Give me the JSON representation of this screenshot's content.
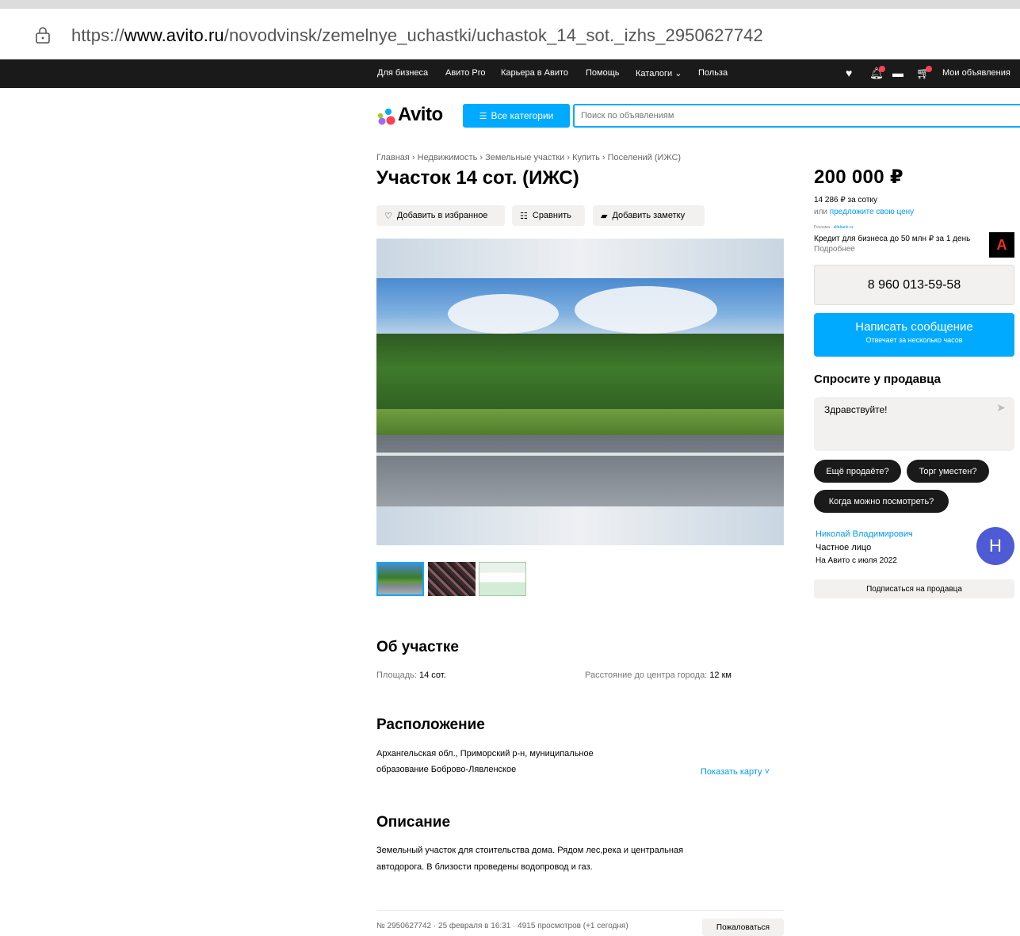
{
  "browser": {
    "url_scheme": "https://",
    "url_host": "www.avito.ru",
    "url_path": "/novodvinsk/zemelnye_uchastki/uchastok_14_sot._izhs_2950627742"
  },
  "topnav": {
    "items": [
      "Для бизнеса",
      "Авито Pro",
      "Карьера в Авито",
      "Помощь",
      "Каталоги ⌄",
      "Польза"
    ],
    "my_ads": "Мои объявления"
  },
  "header": {
    "logo": "Avito",
    "categories_button": "Все категории",
    "search_placeholder": "Поиск по объявлениям"
  },
  "breadcrumbs": "Главная › Недвижимость › Земельные участки › Купить › Поселений (ИЖС)",
  "listing": {
    "title": "Участок 14 сот. (ИЖС)",
    "actions": {
      "favorite": "Добавить в избранное",
      "compare": "Сравнить",
      "note": "Добавить заметку"
    },
    "about": {
      "heading": "Об участке",
      "area_label": "Площадь:",
      "area_value": "14 сот.",
      "distance_label": "Расстояние до центра города:",
      "distance_value": "12 км"
    },
    "location": {
      "heading": "Расположение",
      "line1": "Архангельская обл., Приморский р-н, муниципальное",
      "line2": "образование Боброво-Лявленское",
      "show_map": "Показать карту ˅"
    },
    "description": {
      "heading": "Описание",
      "line1": "Земельный участок для стоительства дома. Рядом лес,река и центральная",
      "line2": "автодорога. В близости проведены водопровод и газ."
    },
    "footer": {
      "meta": "№ 2950627742 · 25 февраля в 16:31 · 4915 просмотров (+1 сегодня)",
      "report": "Пожаловаться"
    }
  },
  "sidebar": {
    "price": "200 000 ₽",
    "price_per_sotka": "14 286 ₽ за сотку",
    "offer_prefix": "или ",
    "offer_link": "предложите свою цену",
    "ad_label": "Реклама ·",
    "ad_domain": "alfabank.ru",
    "ad_text_bold": "Кредит для бизнеса до 50 млн ₽ за 1 день",
    "ad_more": "Подробнее",
    "ad_logo": "А",
    "phone": "8 960 013-59-58",
    "message_button": "Написать сообщение",
    "message_sub": "Отвечает за несколько часов",
    "ask_title": "Спросите у продавца",
    "ask_text": "Здравствуйте!",
    "chips": [
      "Ещё продаёте?",
      "Торг уместен?",
      "Когда можно посмотреть?"
    ],
    "seller_name": "Николай Владимирович",
    "seller_type": "Частное лицо",
    "seller_since": "На Авито с июля 2022",
    "avatar_letter": "Н",
    "subscribe": "Подписаться на продавца"
  },
  "colors": {
    "accent": "#00aaff",
    "link": "#0099f7",
    "dark": "#1a1a1a",
    "badge": "#ff4053"
  }
}
